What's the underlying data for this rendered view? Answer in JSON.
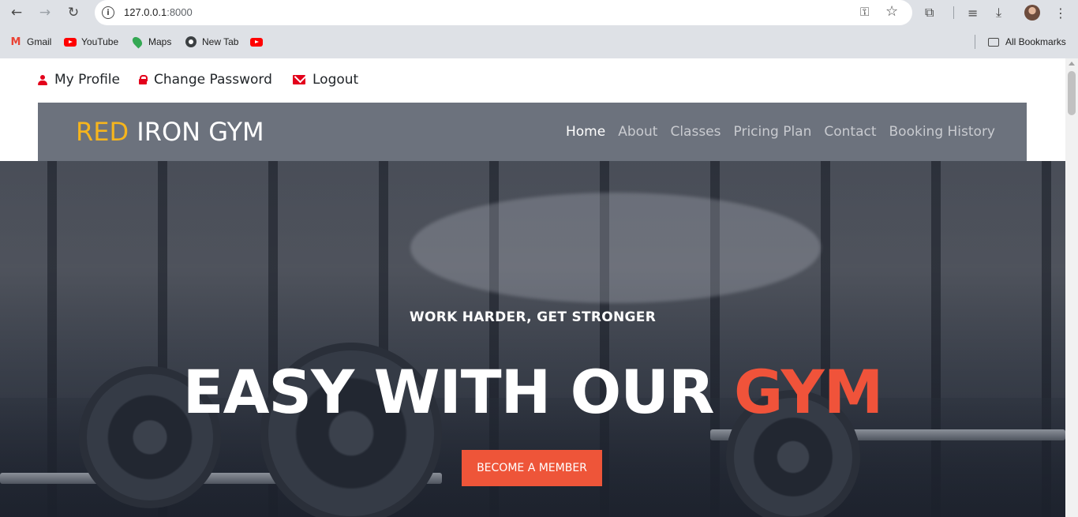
{
  "browser": {
    "url": "127.0.0.1",
    "url_port": ":8000",
    "bookmarks": [
      {
        "label": "Gmail",
        "icon": "gmail-icon"
      },
      {
        "label": "YouTube",
        "icon": "youtube-icon"
      },
      {
        "label": "Maps",
        "icon": "maps-icon"
      },
      {
        "label": "New Tab",
        "icon": "chrome-icon"
      },
      {
        "label": "",
        "icon": "youtube-icon"
      }
    ],
    "all_bookmarks": "All Bookmarks"
  },
  "userbar": {
    "profile": "My Profile",
    "change_password": "Change Password",
    "logout": "Logout"
  },
  "brand": {
    "accent": "RED",
    "rest": " IRON GYM",
    "accent_color": "#f6b51d"
  },
  "nav": {
    "items": [
      "Home",
      "About",
      "Classes",
      "Pricing Plan",
      "Contact",
      "Booking History"
    ],
    "active": "Home"
  },
  "hero": {
    "subtitle": "WORK HARDER, GET STRONGER",
    "title_main": "EASY WITH OUR ",
    "title_accent": "GYM",
    "accent_color": "#f0533a",
    "cta": "BECOME A MEMBER"
  }
}
